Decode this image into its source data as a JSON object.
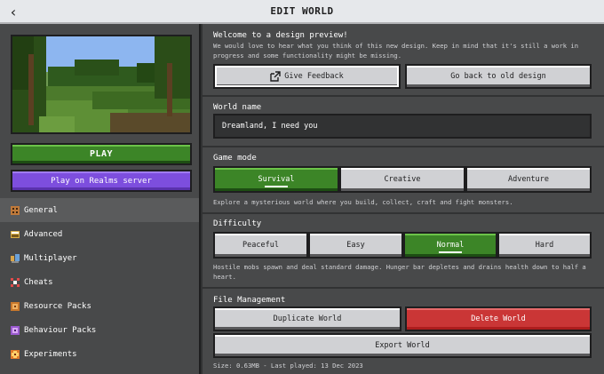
{
  "header": {
    "title": "EDIT WORLD",
    "back_icon": "‹"
  },
  "left": {
    "play_label": "PLAY",
    "realms_label": "Play on Realms server",
    "nav": [
      {
        "label": "General",
        "icon": "general-icon",
        "active": true
      },
      {
        "label": "Advanced",
        "icon": "advanced-icon"
      },
      {
        "label": "Multiplayer",
        "icon": "multiplayer-icon"
      },
      {
        "label": "Cheats",
        "icon": "cheats-icon"
      },
      {
        "label": "Resource Packs",
        "icon": "resource-packs-icon"
      },
      {
        "label": "Behaviour Packs",
        "icon": "behaviour-packs-icon"
      },
      {
        "label": "Experiments",
        "icon": "experiments-icon"
      }
    ]
  },
  "preview": {
    "title": "Welcome to a design preview!",
    "desc": "We would love to hear what you think of this new design. Keep in mind that it's still a work in progress and some functionality might be missing.",
    "feedback_label": "Give Feedback",
    "old_design_label": "Go back to old design"
  },
  "world_name": {
    "title": "World name",
    "value": "Dreamland, I need you"
  },
  "game_mode": {
    "title": "Game mode",
    "options": [
      "Survival",
      "Creative",
      "Adventure"
    ],
    "selected": "Survival",
    "desc": "Explore a mysterious world where you build, collect, craft and fight monsters."
  },
  "difficulty": {
    "title": "Difficulty",
    "options": [
      "Peaceful",
      "Easy",
      "Normal",
      "Hard"
    ],
    "selected": "Normal",
    "desc": "Hostile mobs spawn and deal standard damage. Hunger bar depletes and drains health down to half a heart."
  },
  "file_management": {
    "title": "File Management",
    "duplicate_label": "Duplicate World",
    "delete_label": "Delete World",
    "export_label": "Export World",
    "info": "Size: 0.63MB - Last played: 13 Dec 2023"
  },
  "colors": {
    "green": "#3c8527",
    "purple": "#7d4ede",
    "red": "#ca3636",
    "panel": "#48494a"
  }
}
